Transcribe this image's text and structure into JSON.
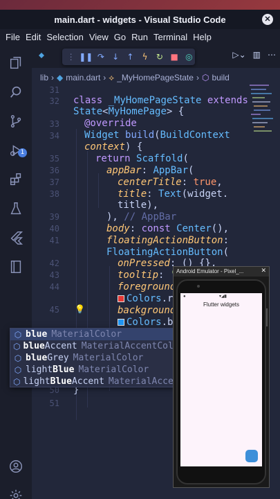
{
  "window": {
    "title": "main.dart - widgets - Visual Studio Code"
  },
  "menu": [
    "File",
    "Edit",
    "Selection",
    "View",
    "Go",
    "Run",
    "Terminal",
    "Help"
  ],
  "breadcrumb": {
    "items": [
      "lib",
      "main.dart",
      "_MyHomePageState",
      "build"
    ],
    "separator": "›"
  },
  "activity_bar": {
    "items": [
      "explorer-icon",
      "search-icon",
      "source-control-icon",
      "run-debug-icon",
      "extensions-icon",
      "testing-icon",
      "flutter-icon",
      "notebook-icon",
      "account-icon",
      "settings-icon"
    ],
    "debug_badge": "1"
  },
  "debug_toolbar": {
    "buttons": [
      "drag-handle",
      "pause",
      "step-over",
      "step-into",
      "step-out",
      "hot-reload",
      "restart",
      "stop",
      "devtools"
    ]
  },
  "editor": {
    "line_numbers": [
      "31",
      "32",
      "",
      "33",
      "34",
      "",
      "35",
      "36",
      "37",
      "38",
      "",
      "39",
      "40",
      "41",
      "",
      "42",
      "43",
      "44",
      "",
      "45",
      "",
      "",
      "",
      "",
      "",
      "50",
      "51"
    ],
    "lines": [
      "",
      "class _MyHomePageState extends",
      "State<MyHomePage> {",
      "  @override",
      "  Widget build(BuildContext",
      "  context) {",
      "    return Scaffold(",
      "      appBar: AppBar(",
      "        centerTitle: true,",
      "        title: Text(widget.",
      "        title),",
      "      ), // AppBar",
      "      body: const Center(),",
      "      floatingActionButton:",
      "      FloatingActionButton(",
      "        onPressed: () {},",
      "        tooltip: 'Add',",
      "        foregroundColor:",
      "        Colors.red",
      "        backgroundColor:",
      "        Colors.blue",
      "",
      "",
      "",
      "",
      "      }",
      ""
    ]
  },
  "suggest": {
    "items": [
      {
        "label": "blue",
        "match": "blue",
        "rest": "",
        "detail": "MaterialColor"
      },
      {
        "label": "blueAccent",
        "match": "blue",
        "rest": "Accent",
        "detail": "MaterialAccentColor"
      },
      {
        "label": "blueGrey",
        "match": "blue",
        "rest": "Grey",
        "detail": "MaterialColor"
      },
      {
        "label": "lightBlue",
        "match_pre": "light",
        "match": "Blue",
        "rest": "",
        "detail": "MaterialColor"
      },
      {
        "label": "lightBlueAccent",
        "match_pre": "light",
        "match": "Blue",
        "rest": "Accent",
        "detail": "MaterialAccentColor"
      }
    ]
  },
  "emulator": {
    "title": "Android Emulator - Pixel_...",
    "app_title": "Flutter widgets"
  },
  "colors": {
    "editor_bg": "#22273a",
    "keyword": "#c099ff",
    "type": "#65bcff",
    "string": "#c3e88d",
    "param": "#ffc777",
    "swatch_red": "#e53935",
    "swatch_blue": "#2196f3",
    "fab": "#3d8fd9"
  }
}
